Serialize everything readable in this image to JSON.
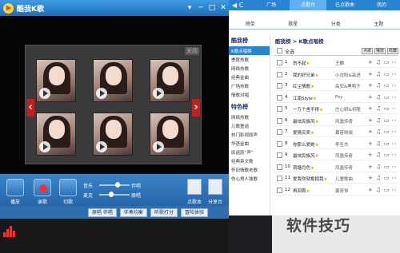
{
  "app": {
    "title": "酷我K歌"
  },
  "window": {
    "controls": [
      "▾",
      "─",
      "□",
      "✕"
    ]
  },
  "video": {
    "close_label": "关闭",
    "prev_icon": "chevron-left-icon",
    "next_icon": "chevron-right-icon"
  },
  "controls": {
    "play_label": "播放",
    "record_label": "录歌",
    "skip_label": "切歌",
    "music_label": "音乐",
    "mic_label": "麦克",
    "accompany_label": "伴唱",
    "original_label": "原唱",
    "lyrics_label": "点歌本",
    "share_label": "分享台"
  },
  "bottom_buttons": [
    "原唱 伴唱",
    "伴奏均衡",
    "听歌打分",
    "冒险体验"
  ],
  "tabs": {
    "nav_back": "◀",
    "nav_refresh": "C",
    "items": [
      "广场",
      "点歌台",
      "已点歌曲",
      "我的"
    ],
    "active": 1
  },
  "subtabs": [
    "榜单",
    "歌星",
    "分类",
    "主题"
  ],
  "sidebar": {
    "head1": "酷我榜",
    "items1": [
      "K歌点唱榜",
      "季度热歌",
      "网络热歌",
      "经典金曲",
      "广场热歌",
      "情歌对唱"
    ],
    "head2": "特色榜",
    "items2": [
      "网络热歌",
      "儿歌童谣",
      "热门影视原声",
      "华语金曲",
      "民谣原“声”",
      "经典英文歌",
      "怀旧情歌老歌",
      "伤心男人独歌"
    ]
  },
  "breadcrumb": "酷我榜 > K歌点唱榜",
  "toolbar": {
    "all_label": "全选",
    "btn1": "点歌",
    "btn2": "播放",
    "btn3": "收藏"
  },
  "songs": [
    {
      "num": "1",
      "name": "伤不起",
      "singer": "王麟"
    },
    {
      "num": "2",
      "name": "我的好兄弟",
      "singer": "小沈阳&高进"
    },
    {
      "num": "3",
      "name": "红尘情歌",
      "singer": "高安&黑鸭子"
    },
    {
      "num": "4",
      "name": "江南Style",
      "singer": "Psy"
    },
    {
      "num": "5",
      "name": "一万个舍不得",
      "singer": "庄心妍&祁隆"
    },
    {
      "num": "6",
      "name": "最炫民族风",
      "singer": "凤凰传奇"
    },
    {
      "num": "7",
      "name": "爱情买卖",
      "singer": "慕容晓晓"
    },
    {
      "num": "8",
      "name": "你那么爱她",
      "singer": "李圣杰"
    },
    {
      "num": "9",
      "name": "最炫民族风",
      "singer": "凤凰传奇"
    },
    {
      "num": "10",
      "name": "荷塘月色",
      "singer": "凤凰传奇"
    },
    {
      "num": "11",
      "name": "爱我你就抱抱我",
      "singer": "儿童歌曲"
    },
    {
      "num": "12",
      "name": "再回首",
      "singer": "姜育恒"
    }
  ],
  "watermark": "软件技巧",
  "colors": {
    "accent": "#2a83d1",
    "record": "#e33"
  }
}
